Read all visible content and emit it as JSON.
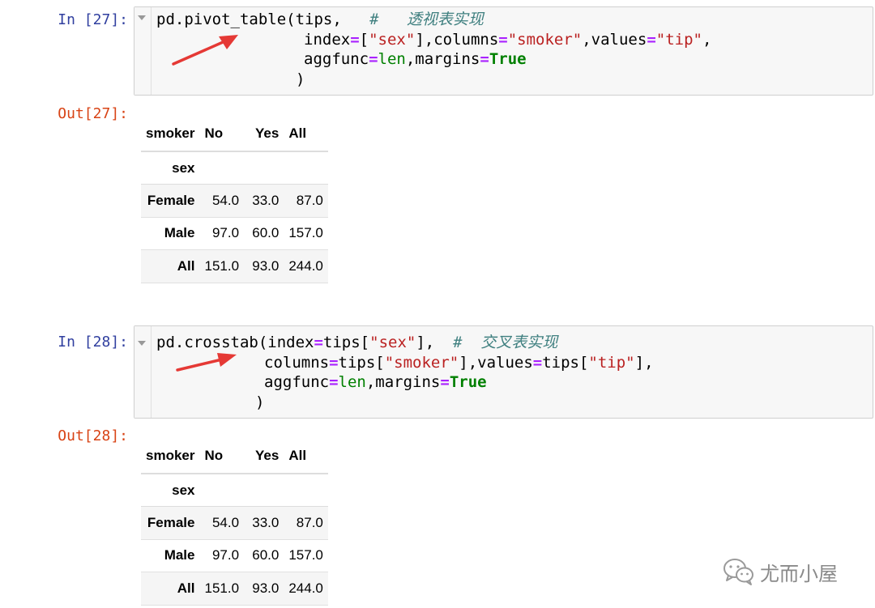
{
  "cell1": {
    "in_prompt": "In [27]:",
    "out_prompt": "Out[27]:",
    "code": {
      "l1_a": "pd.pivot_table(tips,",
      "l1_comment": "#   透视表实现",
      "l2_a": "index",
      "l2_b": "[",
      "l2_str1": "\"sex\"",
      "l2_c": "],columns",
      "l2_str2": "\"smoker\"",
      "l2_d": ",values",
      "l2_str3": "\"tip\"",
      "l2_e": ",",
      "l3_a": "aggfunc",
      "l3_len": "len",
      "l3_b": ",margins",
      "l3_true": "True",
      "l4": ")",
      "eq": "="
    }
  },
  "cell2": {
    "in_prompt": "In [28]:",
    "out_prompt": "Out[28]:",
    "code": {
      "l1_a": "pd.crosstab(index",
      "l1_b": "tips[",
      "l1_str": "\"sex\"",
      "l1_c": "],",
      "l1_comment": "#  交叉表实现",
      "l2_a": "columns",
      "l2_b": "tips[",
      "l2_str1": "\"smoker\"",
      "l2_c": "],values",
      "l2_d": "tips[",
      "l2_str2": "\"tip\"",
      "l2_e": "],",
      "l3_a": "aggfunc",
      "l3_len": "len",
      "l3_b": ",margins",
      "l3_true": "True",
      "l4": ")",
      "eq": "="
    }
  },
  "table": {
    "columns_name": "smoker",
    "columns": [
      "No",
      "Yes",
      "All"
    ],
    "index_name": "sex",
    "rows": [
      {
        "label": "Female",
        "values": [
          "54.0",
          "33.0",
          "87.0"
        ]
      },
      {
        "label": "Male",
        "values": [
          "97.0",
          "60.0",
          "157.0"
        ]
      },
      {
        "label": "All",
        "values": [
          "151.0",
          "93.0",
          "244.0"
        ]
      }
    ]
  },
  "watermark": {
    "text": "尤而小屋",
    "icon": "wechat-icon"
  },
  "colors": {
    "in_prompt": "#303f9f",
    "out_prompt": "#d84315",
    "operator": "#aa22ff",
    "string": "#ba2121",
    "builtin": "#008000",
    "comment": "#408080",
    "arrow": "#e53935"
  }
}
